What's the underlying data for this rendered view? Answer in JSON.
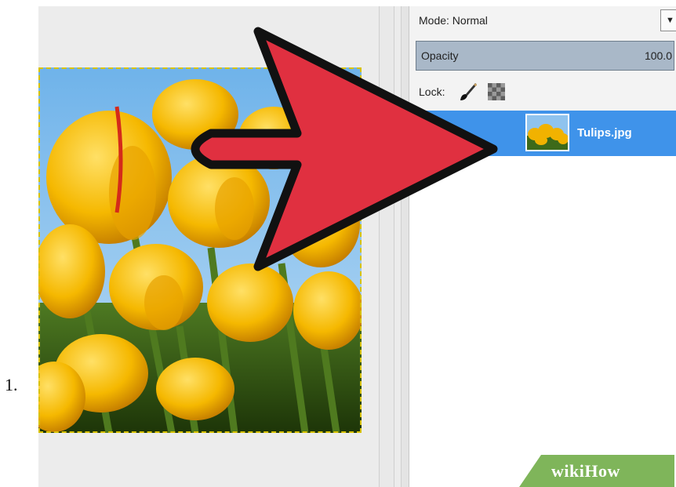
{
  "step": {
    "number": "1."
  },
  "layers_panel": {
    "mode_label": "Mode: Normal",
    "mode_dropdown_icon": "chevron-down-icon",
    "opacity_label": "Opacity",
    "opacity_value": "100.0",
    "lock_label": "Lock:",
    "lock_icons": [
      "brush-icon",
      "alpha-checker-icon"
    ],
    "layers": [
      {
        "name": "Tulips.jpg",
        "selected": true
      }
    ]
  },
  "watermark": {
    "text": "wikiHow"
  },
  "colors": {
    "selection": "#3f93ea",
    "opacity_bar": "#a9b8c8",
    "arrow_fill": "#e03040",
    "watermark_band": "#7fb55a"
  }
}
